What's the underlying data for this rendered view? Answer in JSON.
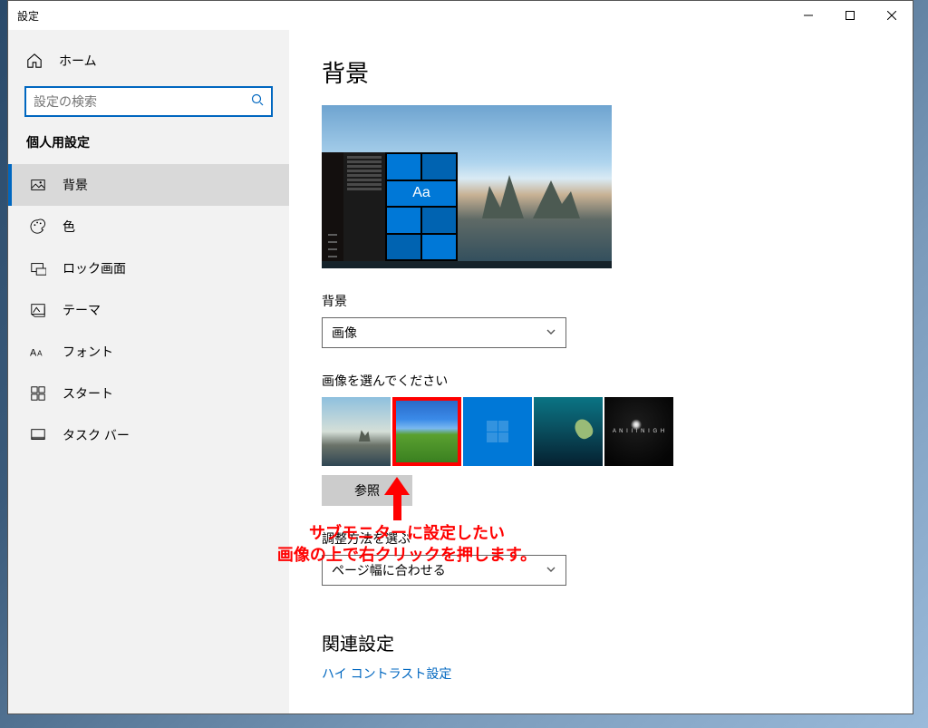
{
  "window": {
    "title": "設定"
  },
  "sidebar": {
    "home": "ホーム",
    "search_placeholder": "設定の検索",
    "category": "個人用設定",
    "items": [
      {
        "label": "背景"
      },
      {
        "label": "色"
      },
      {
        "label": "ロック画面"
      },
      {
        "label": "テーマ"
      },
      {
        "label": "フォント"
      },
      {
        "label": "スタート"
      },
      {
        "label": "タスク バー"
      }
    ]
  },
  "page": {
    "title": "背景",
    "preview_tile_text": "Aa",
    "background_label": "背景",
    "background_dropdown": "画像",
    "choose_image_label": "画像を選んでください",
    "thumb5_text": "A N I I I  N I G H",
    "browse": "参照",
    "fit_label": "調整方法を選ぶ",
    "fit_dropdown": "ページ幅に合わせる",
    "related_title": "関連設定",
    "related_link": "ハイ コントラスト設定"
  },
  "annotation": {
    "line1": "サブモニターに設定したい",
    "line2": "画像の上で右クリックを押します。"
  }
}
